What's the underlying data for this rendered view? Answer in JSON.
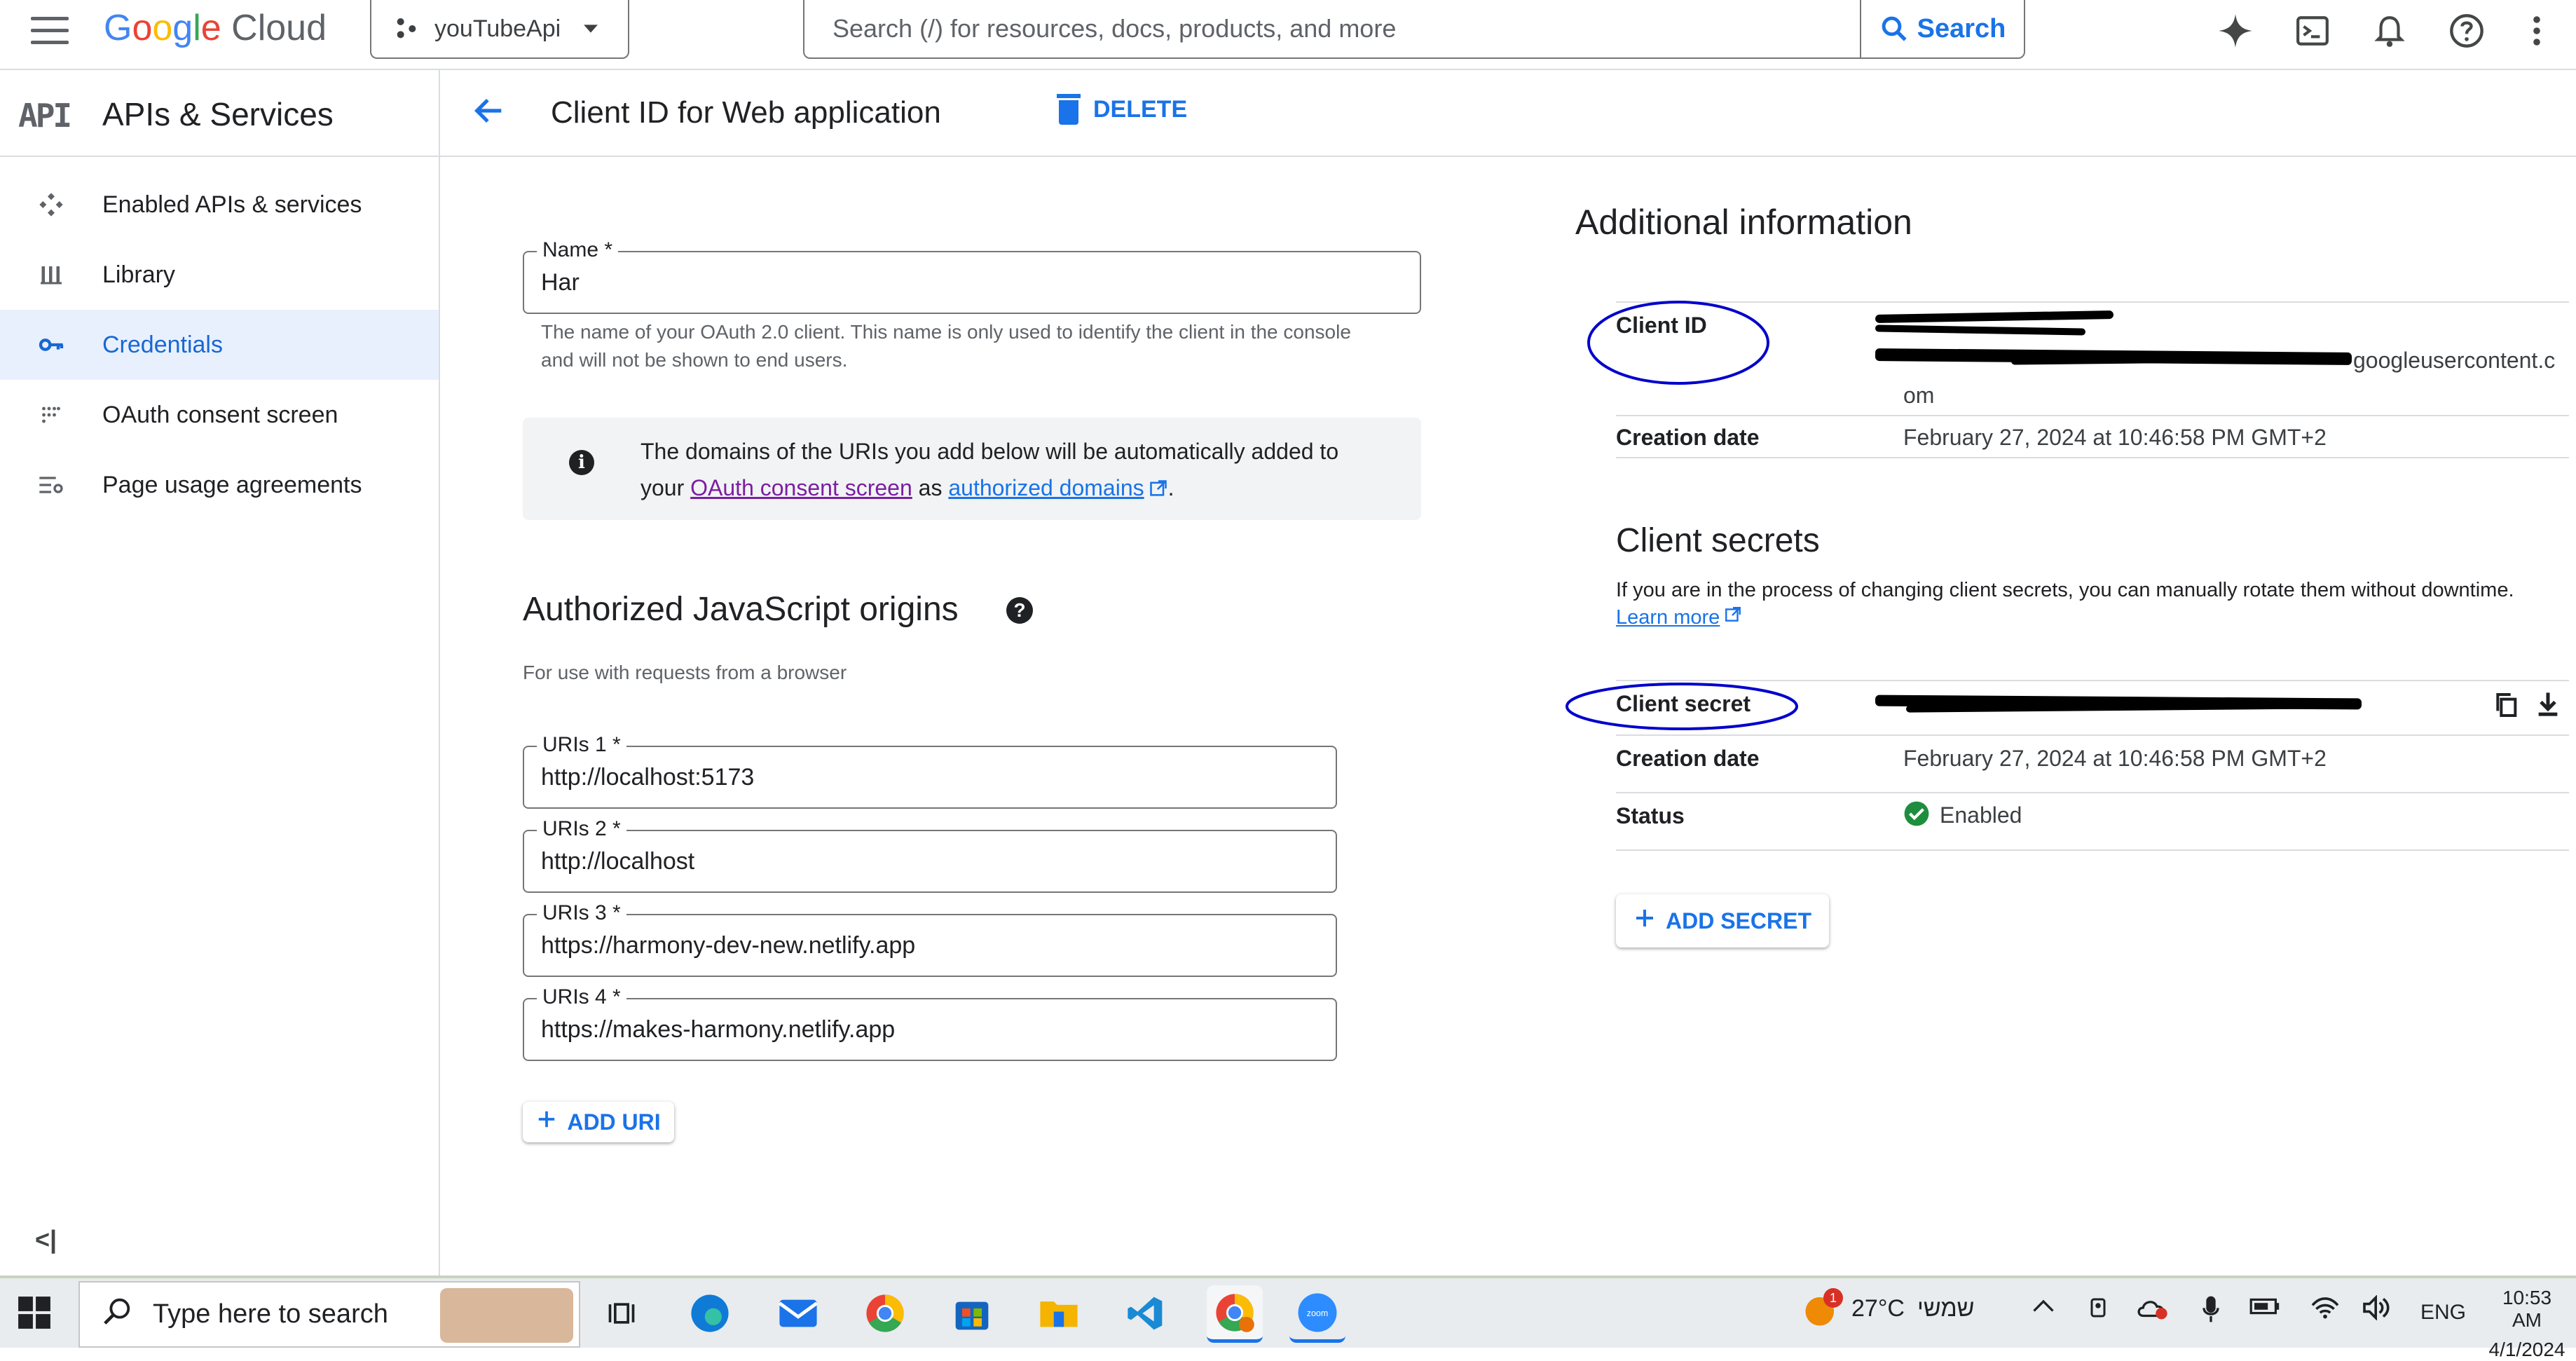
{
  "topbar": {
    "logo_google": [
      "G",
      "o",
      "o",
      "g",
      "l",
      "e"
    ],
    "logo_cloud": "Cloud",
    "project": "youTubeApi",
    "search_placeholder": "Search (/) for resources, docs, products, and more",
    "search_button": "Search"
  },
  "sidebar": {
    "badge": "API",
    "title": "APIs & Services",
    "items": [
      {
        "label": "Enabled APIs & services",
        "icon": "enabled-apis-icon"
      },
      {
        "label": "Library",
        "icon": "library-icon"
      },
      {
        "label": "Credentials",
        "icon": "key-icon",
        "active": true
      },
      {
        "label": "OAuth consent screen",
        "icon": "oauth-consent-icon"
      },
      {
        "label": "Page usage agreements",
        "icon": "settings-list-icon"
      }
    ],
    "collapse": "<|"
  },
  "header": {
    "title": "Client ID for Web application",
    "delete": "DELETE"
  },
  "form": {
    "name_label": "Name *",
    "name_value": "Har",
    "name_help": "The name of your OAuth 2.0 client. This name is only used to identify the client in the console and will not be shown to end users.",
    "info_prefix": "The domains of the URIs you add below will be automatically added to your ",
    "info_link1": "OAuth consent screen",
    "info_mid": " as ",
    "info_link2": "authorized domains",
    "info_suffix": ".",
    "origins_title": "Authorized JavaScript origins",
    "origins_help": "For use with requests from a browser",
    "uris": [
      {
        "label": "URIs 1 *",
        "value": "http://localhost:5173"
      },
      {
        "label": "URIs 2 *",
        "value": "http://localhost"
      },
      {
        "label": "URIs 3 *",
        "value": "https://harmony-dev-new.netlify.app"
      },
      {
        "label": "URIs 4 *",
        "value": "https://makes-harmony.netlify.app"
      }
    ],
    "add_uri": "ADD URI"
  },
  "additional": {
    "title": "Additional information",
    "client_id_label": "Client ID",
    "client_id_visible": "googleusercontent.c",
    "client_id_tail": "om",
    "creation_label": "Creation date",
    "creation_value": "February 27, 2024 at 10:46:58 PM GMT+2",
    "secrets_title": "Client secrets",
    "secrets_help": "If you are in the process of changing client secrets, you can manually rotate them without downtime.",
    "learn_more": "Learn more",
    "secret_label": "Client secret",
    "secret_creation_label": "Creation date",
    "secret_creation_value": "February 27, 2024 at 10:46:58 PM GMT+2",
    "status_label": "Status",
    "status_value": "Enabled",
    "add_secret": "ADD SECRET"
  },
  "taskbar": {
    "search_placeholder": "Type here to search",
    "weather_badge": "1",
    "weather": "27°C",
    "weather_day": "שמשי",
    "lang": "ENG",
    "time": "10:53 AM",
    "date": "4/1/2024",
    "zoom_label": "zoom"
  },
  "colors": {
    "accent": "#1a73e8",
    "active_bg": "#e8f0fe",
    "status_green": "#1e8e3e",
    "annotation_blue": "#0000cc"
  }
}
